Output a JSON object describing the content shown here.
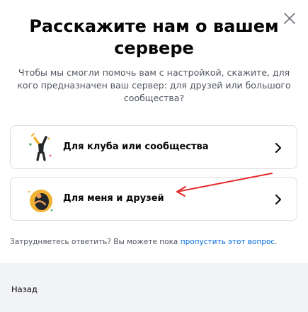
{
  "modal": {
    "title": "Расскажите нам о вашем сервере",
    "subtitle": "Чтобы мы смогли помочь вам с настройкой, скажите, для кого предназначен ваш сервер: для друзей или большого сообщества?",
    "close_icon": "close-icon"
  },
  "options": [
    {
      "label": "Для клуба или сообщества",
      "icon": "club-community-icon"
    },
    {
      "label": "Для меня и друзей",
      "icon": "me-and-friends-icon"
    }
  ],
  "skip": {
    "prefix": "Затрудняетесь ответить? Вы можете пока",
    "link": "пропустить этот вопрос",
    "suffix": "."
  },
  "footer": {
    "back_label": "Назад"
  },
  "colors": {
    "title": "#060607",
    "muted": "#4f5660",
    "link": "#0068e0",
    "border": "#dcdde1",
    "footer_bg": "#f2f3f5",
    "annotation": "#e8282b"
  }
}
